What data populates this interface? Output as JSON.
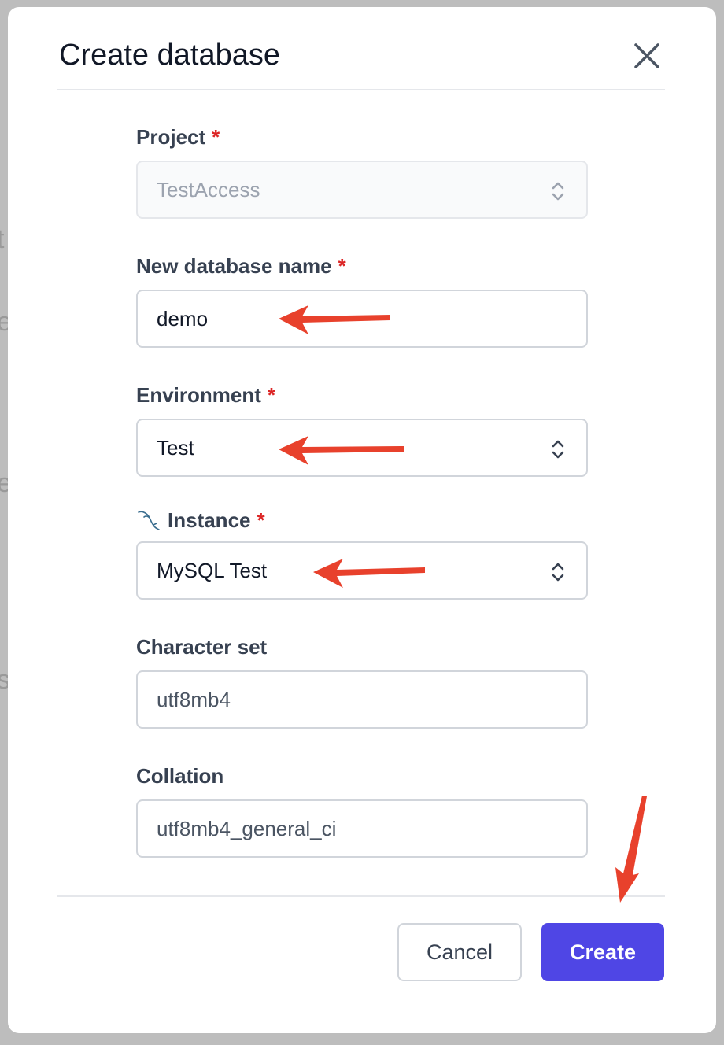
{
  "dialog": {
    "title": "Create database",
    "close_icon": "close-icon"
  },
  "fields": {
    "project": {
      "label": "Project",
      "required": "*",
      "value": "TestAccess"
    },
    "db_name": {
      "label": "New database name",
      "required": "*",
      "value": "demo"
    },
    "environment": {
      "label": "Environment",
      "required": "*",
      "value": "Test"
    },
    "instance": {
      "label": "Instance",
      "required": "*",
      "value": "MySQL Test",
      "icon": "mysql-dolphin-icon"
    },
    "charset": {
      "label": "Character set",
      "value": "utf8mb4"
    },
    "collation": {
      "label": "Collation",
      "value": "utf8mb4_general_ci"
    }
  },
  "footer": {
    "cancel_label": "Cancel",
    "create_label": "Create"
  },
  "colors": {
    "primary": "#4f46e5",
    "required": "#dc2626",
    "annotation_arrow": "#e8412c"
  }
}
